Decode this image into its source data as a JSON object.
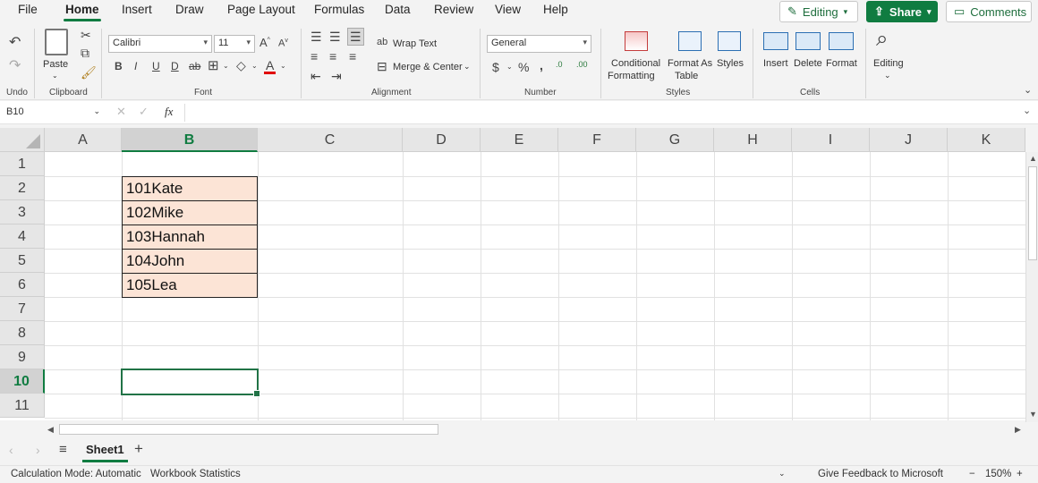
{
  "menu": {
    "tabs": [
      "File",
      "Home",
      "Insert",
      "Draw",
      "Page Layout",
      "Formulas",
      "Data",
      "Review",
      "View",
      "Help"
    ],
    "active": "Home",
    "editing_label": "Editing",
    "share_label": "Share",
    "comments_label": "Comments"
  },
  "ribbon": {
    "undo_group": "Undo",
    "clipboard_group": "Clipboard",
    "paste_label": "Paste",
    "font_group": "Font",
    "font_name": "Calibri",
    "font_size": "11",
    "alignment_group": "Alignment",
    "wrap_text": "Wrap Text",
    "merge_center": "Merge & Center",
    "number_group": "Number",
    "number_format": "General",
    "styles_group": "Styles",
    "conditional_formatting_line1": "Conditional",
    "conditional_formatting_line2": "Formatting",
    "format_as_table_line1": "Format As",
    "format_as_table_line2": "Table",
    "styles_label": "Styles",
    "cells_group": "Cells",
    "insert_label": "Insert",
    "delete_label": "Delete",
    "format_label": "Format",
    "editing_label": "Editing"
  },
  "formula_bar": {
    "name_box": "B10",
    "fx": "fx",
    "value": ""
  },
  "columns": [
    "A",
    "B",
    "C",
    "D",
    "E",
    "F",
    "G",
    "H",
    "I",
    "J",
    "K"
  ],
  "selected_column": "B",
  "rows": [
    "1",
    "2",
    "3",
    "4",
    "5",
    "6",
    "7",
    "8",
    "9",
    "10",
    "11"
  ],
  "selected_row": "10",
  "cells": {
    "B2": "101Kate",
    "B3": "102Mike",
    "B4": "103Hannah",
    "B5": "104John",
    "B6": "105Lea"
  },
  "cell_fill": "#fce4d6",
  "accent": "#107c41",
  "sheets": [
    "Sheet1"
  ],
  "status": {
    "calc_mode": "Calculation Mode: Automatic",
    "workbook_stats": "Workbook Statistics",
    "feedback": "Give Feedback to Microsoft",
    "zoom": "150%"
  }
}
